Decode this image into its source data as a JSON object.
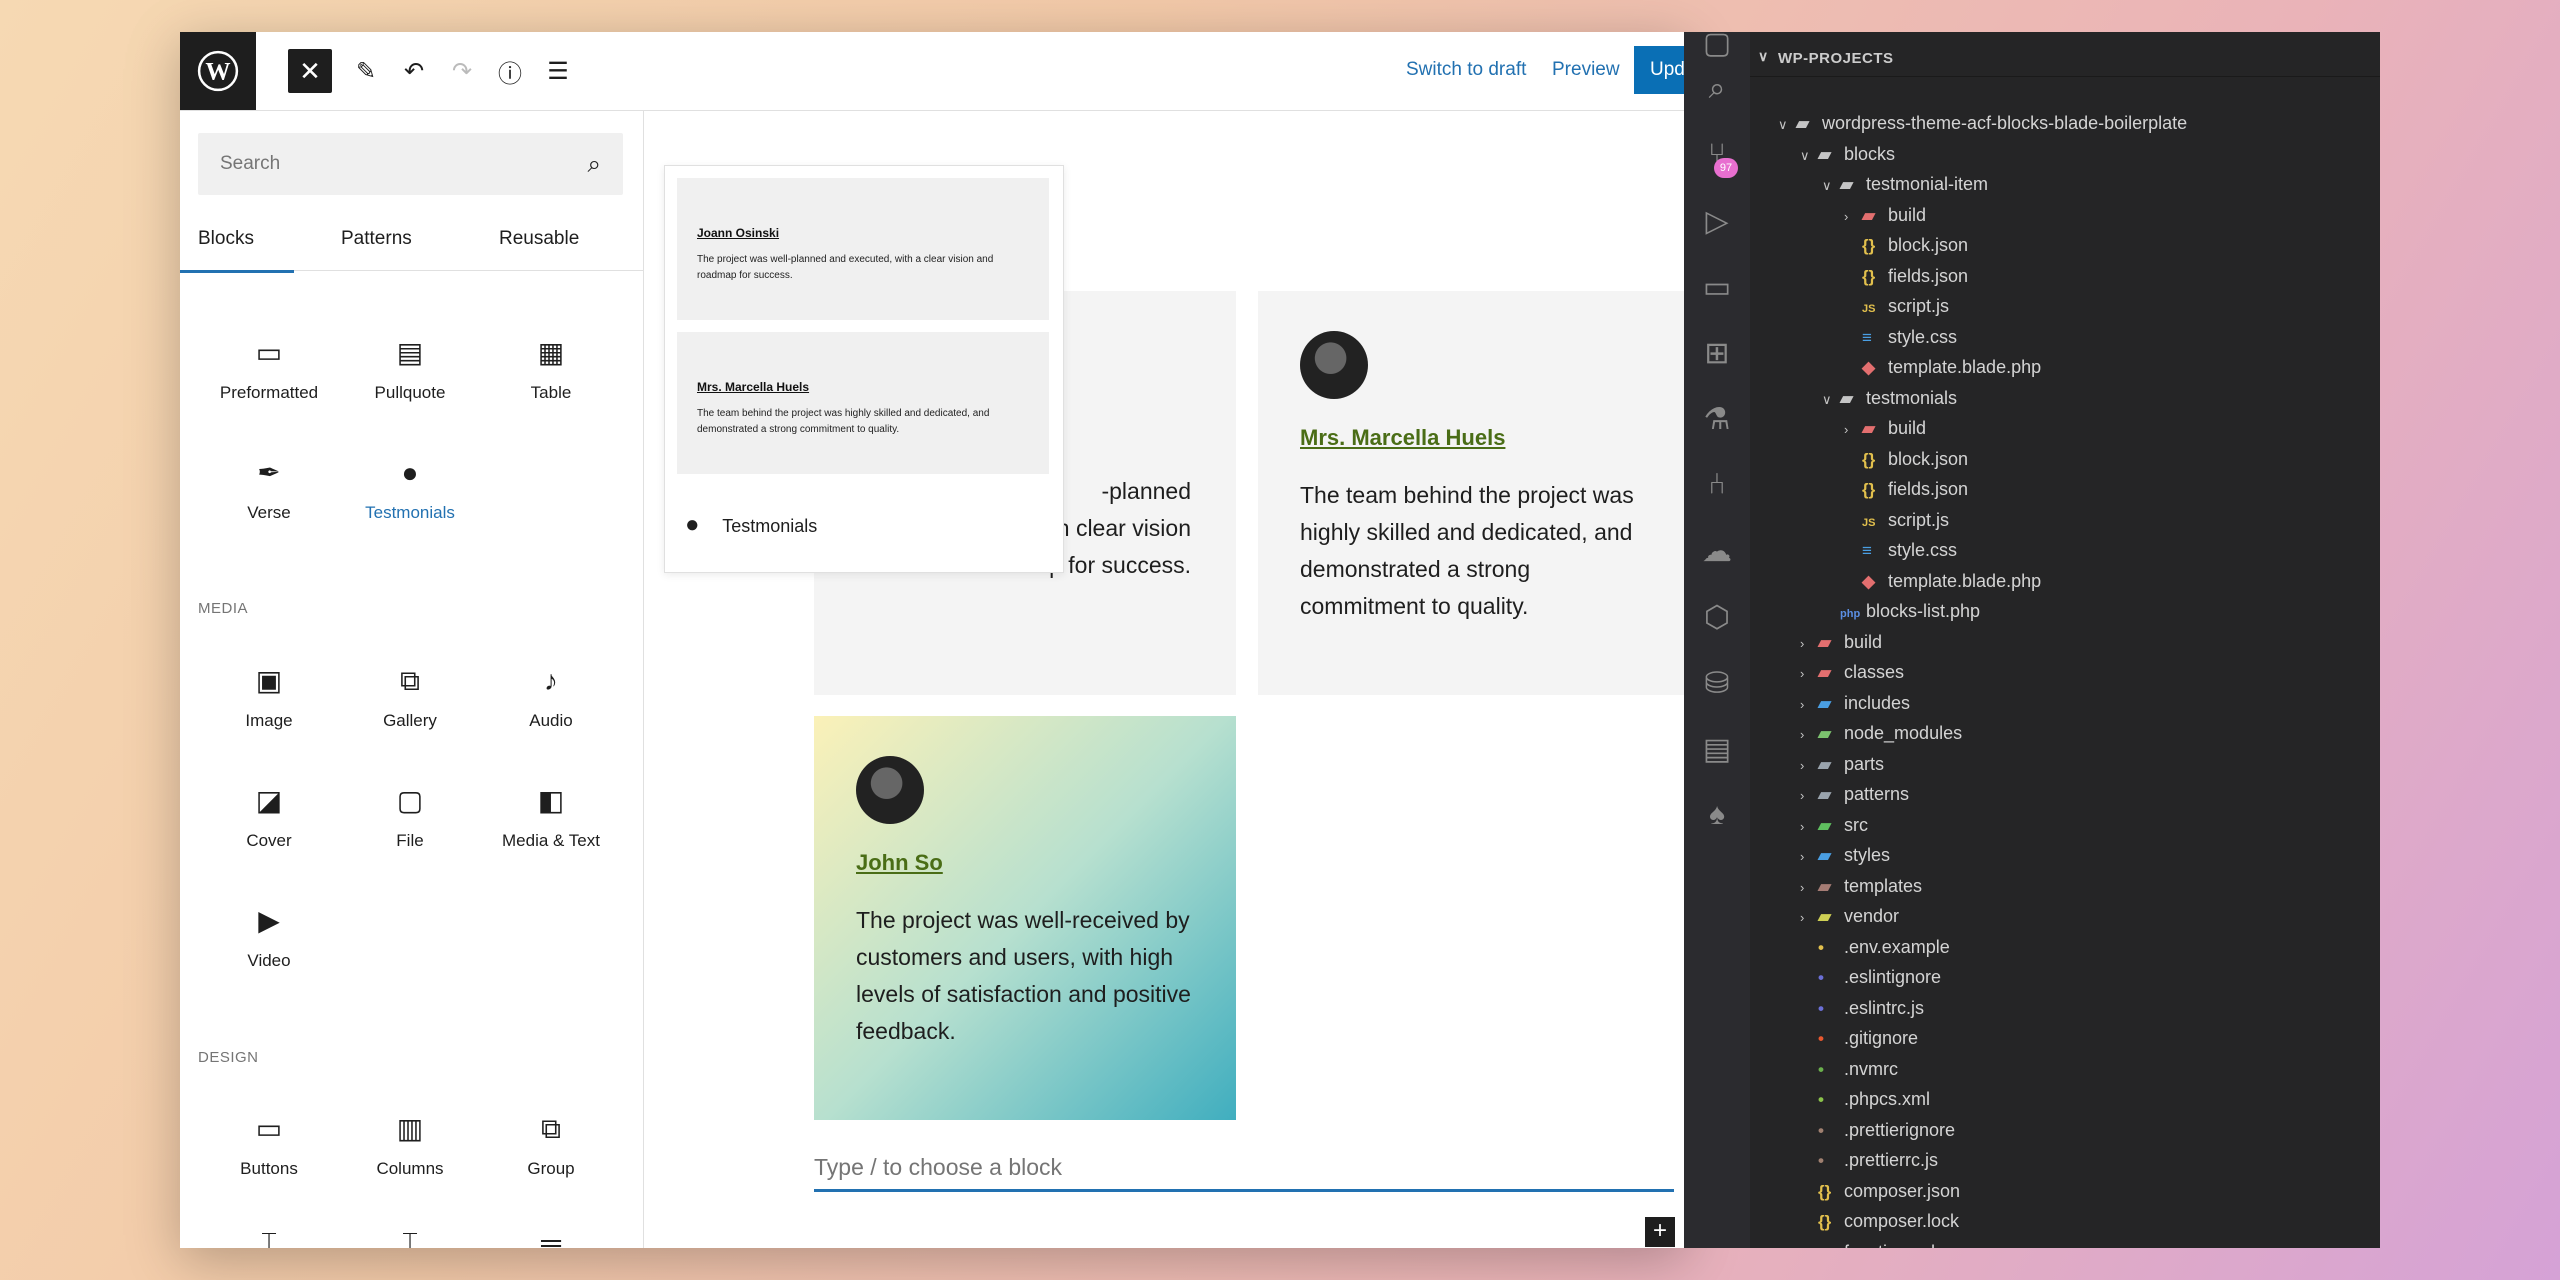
{
  "wp": {
    "toolbar": {
      "switch_to_draft": "Switch to draft",
      "preview": "Preview",
      "update": "Upd"
    },
    "inserter": {
      "search_placeholder": "Search",
      "tabs": [
        "Blocks",
        "Patterns",
        "Reusable"
      ],
      "blocks_row1": [
        {
          "label": "Preformatted",
          "icon": "preformatted-icon"
        },
        {
          "label": "Pullquote",
          "icon": "pullquote-icon"
        },
        {
          "label": "Table",
          "icon": "table-icon"
        }
      ],
      "blocks_row2": [
        {
          "label": "Verse",
          "icon": "verse-icon"
        },
        {
          "label": "Testmonials",
          "icon": "speech-bubble-icon"
        }
      ],
      "media_label": "MEDIA",
      "media_row1": [
        {
          "label": "Image",
          "icon": "image-icon"
        },
        {
          "label": "Gallery",
          "icon": "gallery-icon"
        },
        {
          "label": "Audio",
          "icon": "audio-icon"
        }
      ],
      "media_row2": [
        {
          "label": "Cover",
          "icon": "cover-icon"
        },
        {
          "label": "File",
          "icon": "file-icon"
        },
        {
          "label": "Media & Text",
          "icon": "media-text-icon"
        }
      ],
      "media_row3": [
        {
          "label": "Video",
          "icon": "video-icon"
        }
      ],
      "design_label": "DESIGN",
      "design_row1": [
        {
          "label": "Buttons",
          "icon": "buttons-icon"
        },
        {
          "label": "Columns",
          "icon": "columns-icon"
        },
        {
          "label": "Group",
          "icon": "group-icon"
        }
      ]
    },
    "preview": {
      "items": [
        {
          "name": "Joann Osinski",
          "text": "The project was well-planned and executed, with a clear vision and roadmap for success."
        },
        {
          "name": "Mrs. Marcella Huels",
          "text": "The team behind the project was highly skilled and dedicated, and demonstrated a strong commitment to quality."
        }
      ],
      "footer_label": "Testmonials"
    },
    "cards": [
      {
        "name": "",
        "quote_partial": "-planned\nh clear vision\nand roadmap for success."
      },
      {
        "name": "Mrs. Marcella Huels",
        "quote": "The team behind the project was highly skilled and dedicated, and demonstrated a strong commitment to quality."
      },
      {
        "name": "John So",
        "quote": "The project was well-received by customers and users, with high levels of satisfaction and positive feedback."
      }
    ],
    "type_block_placeholder": "Type / to choose a block"
  },
  "vscode": {
    "explorer_title": "WP-PROJECTS",
    "scm_badge": "97",
    "tree": [
      {
        "label": "wordpress-theme-acf-blocks-blade-boilerplate",
        "depth": 1,
        "type": "folder-open",
        "color": "#c5c5c5"
      },
      {
        "label": "blocks",
        "depth": 2,
        "type": "folder-open",
        "color": "#c5c5c5"
      },
      {
        "label": "testmonial-item",
        "depth": 3,
        "type": "folder-open",
        "color": "#c5c5c5"
      },
      {
        "label": "build",
        "depth": 4,
        "type": "folder",
        "color": "#e36f6f"
      },
      {
        "label": "block.json",
        "depth": 4,
        "type": "json",
        "color": "#e2c04d"
      },
      {
        "label": "fields.json",
        "depth": 4,
        "type": "json",
        "color": "#e2c04d"
      },
      {
        "label": "script.js",
        "depth": 4,
        "type": "js",
        "color": "#e2c04d"
      },
      {
        "label": "style.css",
        "depth": 4,
        "type": "css",
        "color": "#4a9fe3"
      },
      {
        "label": "template.blade.php",
        "depth": 4,
        "type": "blade",
        "color": "#e36f6f"
      },
      {
        "label": "testmonials",
        "depth": 3,
        "type": "folder-open",
        "color": "#c5c5c5"
      },
      {
        "label": "build",
        "depth": 4,
        "type": "folder",
        "color": "#e36f6f"
      },
      {
        "label": "block.json",
        "depth": 4,
        "type": "json",
        "color": "#e2c04d"
      },
      {
        "label": "fields.json",
        "depth": 4,
        "type": "json",
        "color": "#e2c04d"
      },
      {
        "label": "script.js",
        "depth": 4,
        "type": "js",
        "color": "#e2c04d"
      },
      {
        "label": "style.css",
        "depth": 4,
        "type": "css",
        "color": "#4a9fe3"
      },
      {
        "label": "template.blade.php",
        "depth": 4,
        "type": "blade",
        "color": "#e36f6f"
      },
      {
        "label": "blocks-list.php",
        "depth": 3,
        "type": "php",
        "color": "#5b8fe3"
      },
      {
        "label": "build",
        "depth": 2,
        "type": "folder",
        "color": "#e36f6f"
      },
      {
        "label": "classes",
        "depth": 2,
        "type": "folder",
        "color": "#e36f6f"
      },
      {
        "label": "includes",
        "depth": 2,
        "type": "folder",
        "color": "#4a9fe3"
      },
      {
        "label": "node_modules",
        "depth": 2,
        "type": "folder",
        "color": "#7cc36e"
      },
      {
        "label": "parts",
        "depth": 2,
        "type": "folder",
        "color": "#9aa4ad"
      },
      {
        "label": "patterns",
        "depth": 2,
        "type": "folder",
        "color": "#9aa4ad"
      },
      {
        "label": "src",
        "depth": 2,
        "type": "folder",
        "color": "#5fbf5f"
      },
      {
        "label": "styles",
        "depth": 2,
        "type": "folder",
        "color": "#4a9fe3"
      },
      {
        "label": "templates",
        "depth": 2,
        "type": "folder",
        "color": "#a57c74"
      },
      {
        "label": "vendor",
        "depth": 2,
        "type": "folder",
        "color": "#cfd054"
      },
      {
        "label": ".env.example",
        "depth": 2,
        "type": "file",
        "color": "#e2c04d"
      },
      {
        "label": ".eslintignore",
        "depth": 2,
        "type": "file",
        "color": "#6b6fd6"
      },
      {
        "label": ".eslintrc.js",
        "depth": 2,
        "type": "file",
        "color": "#6b6fd6"
      },
      {
        "label": ".gitignore",
        "depth": 2,
        "type": "file",
        "color": "#e8582f"
      },
      {
        "label": ".nvmrc",
        "depth": 2,
        "type": "file",
        "color": "#6ab04c"
      },
      {
        "label": ".phpcs.xml",
        "depth": 2,
        "type": "file",
        "color": "#8bc34a"
      },
      {
        "label": ".prettierignore",
        "depth": 2,
        "type": "file",
        "color": "#a08070"
      },
      {
        "label": ".prettierrc.js",
        "depth": 2,
        "type": "file",
        "color": "#a08070"
      },
      {
        "label": "composer.json",
        "depth": 2,
        "type": "json",
        "color": "#e2c04d"
      },
      {
        "label": "composer.lock",
        "depth": 2,
        "type": "json",
        "color": "#e2c04d"
      },
      {
        "label": "functions.php",
        "depth": 2,
        "type": "php",
        "color": "#5b8fe3"
      }
    ]
  }
}
